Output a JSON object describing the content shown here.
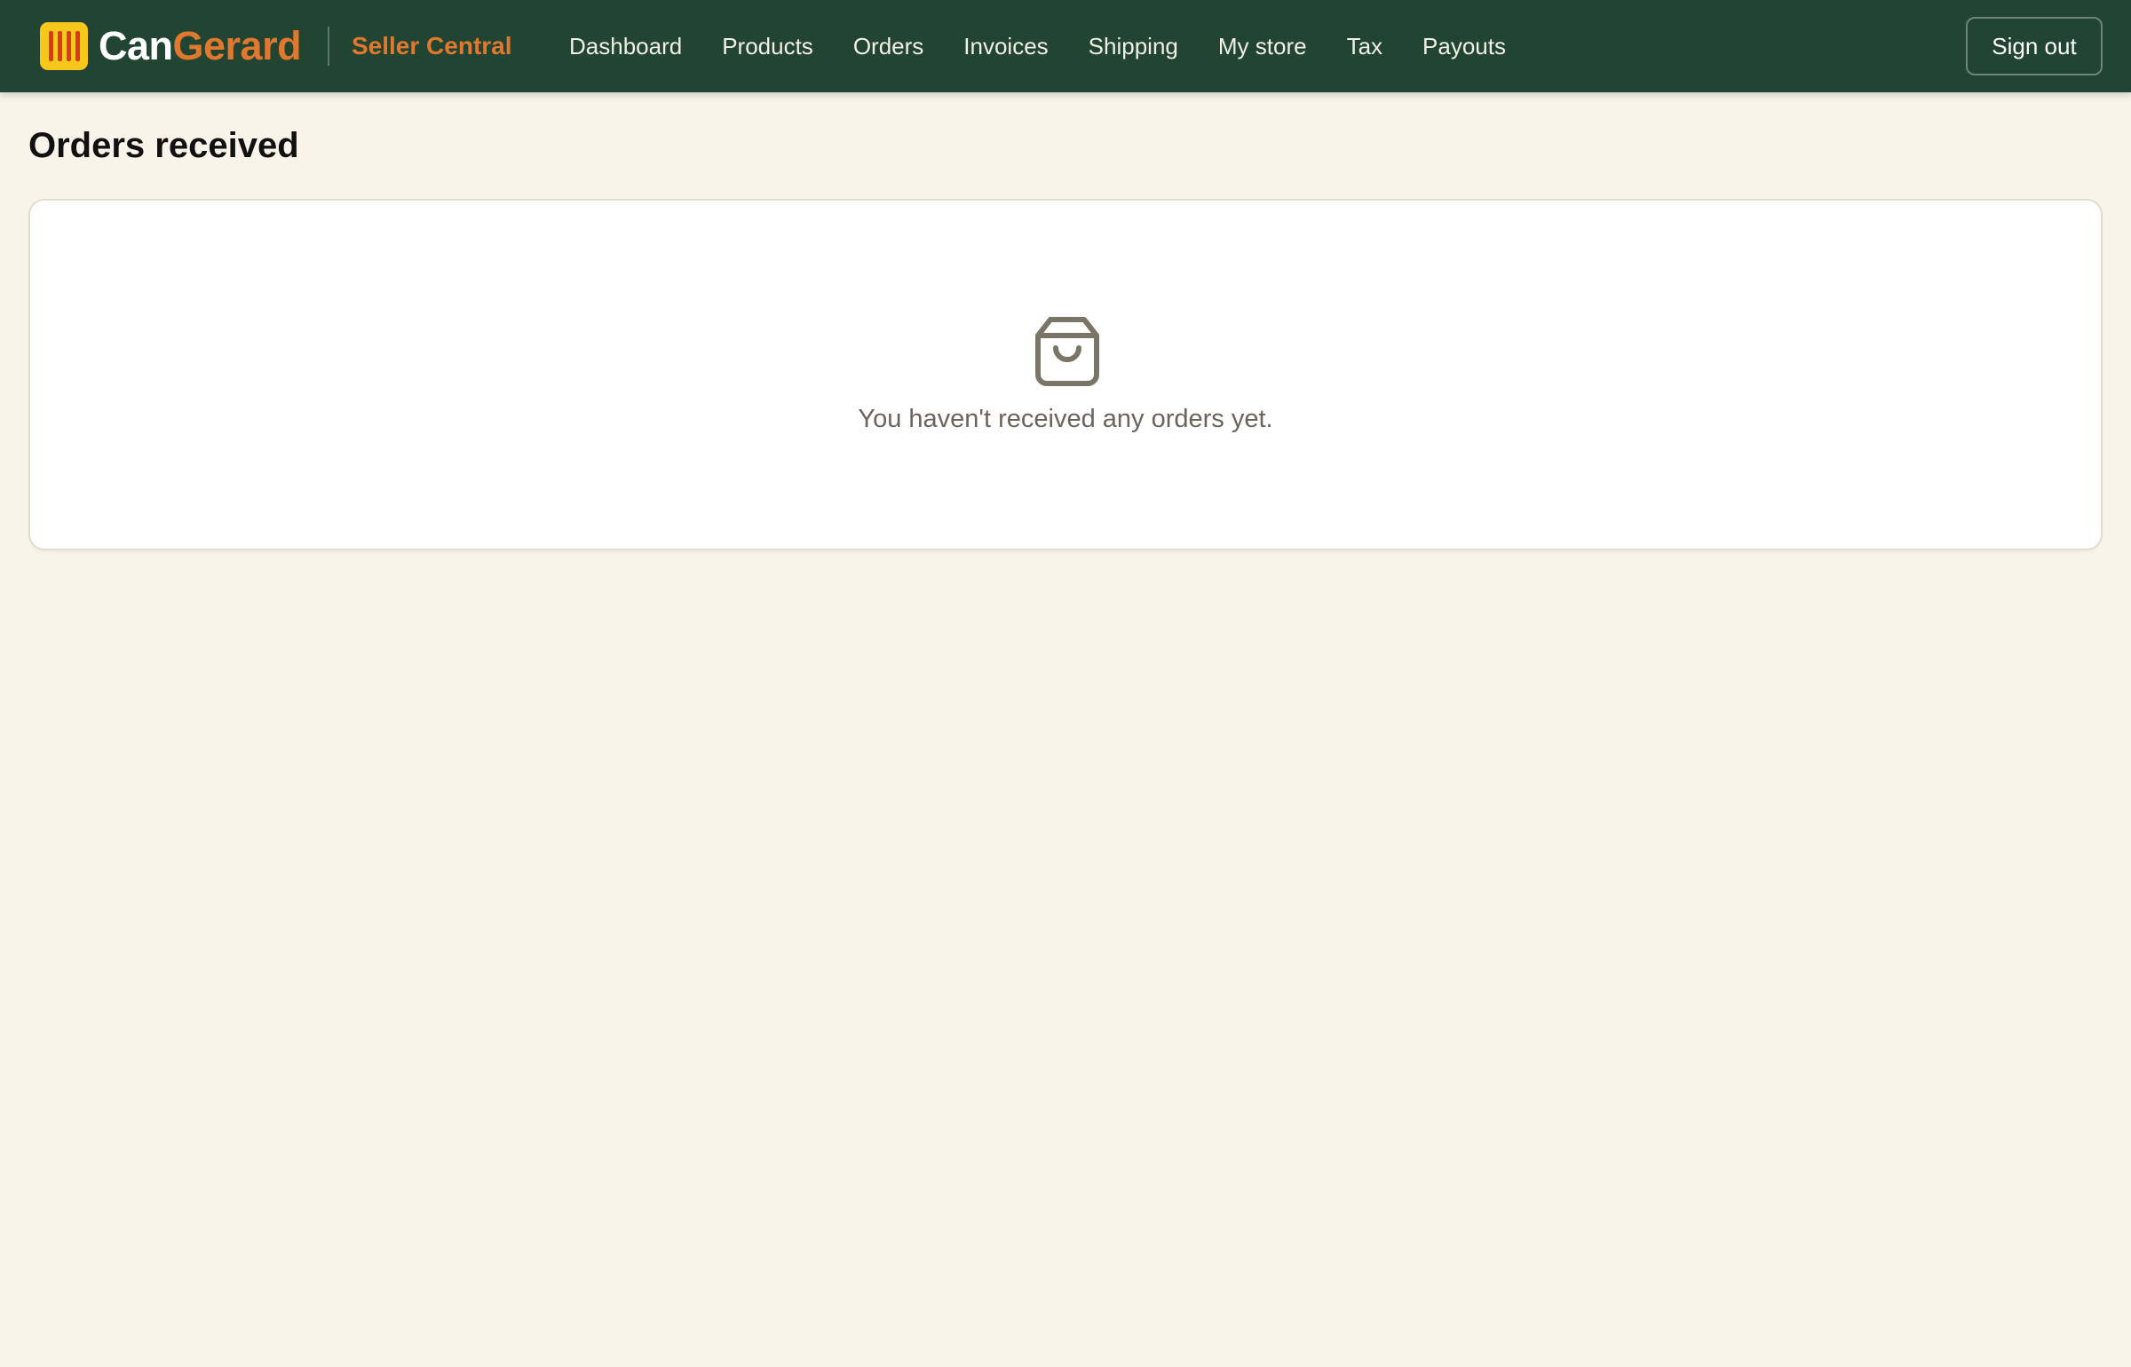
{
  "brand": {
    "name_part1": "Can",
    "name_part2": "Gerard",
    "product": "Seller Central",
    "colors": {
      "header_bg": "#214433",
      "accent": "#e0782e",
      "logo_yellow": "#f7c71c",
      "logo_red": "#d93a1f",
      "page_bg": "#f8f4ea"
    }
  },
  "nav": {
    "items": [
      {
        "label": "Dashboard"
      },
      {
        "label": "Products"
      },
      {
        "label": "Orders"
      },
      {
        "label": "Invoices"
      },
      {
        "label": "Shipping"
      },
      {
        "label": "My store"
      },
      {
        "label": "Tax"
      },
      {
        "label": "Payouts"
      }
    ],
    "signout_label": "Sign out"
  },
  "page": {
    "title": "Orders received"
  },
  "empty_state": {
    "icon": "shopping-bag-icon",
    "message": "You haven't received any orders yet."
  }
}
